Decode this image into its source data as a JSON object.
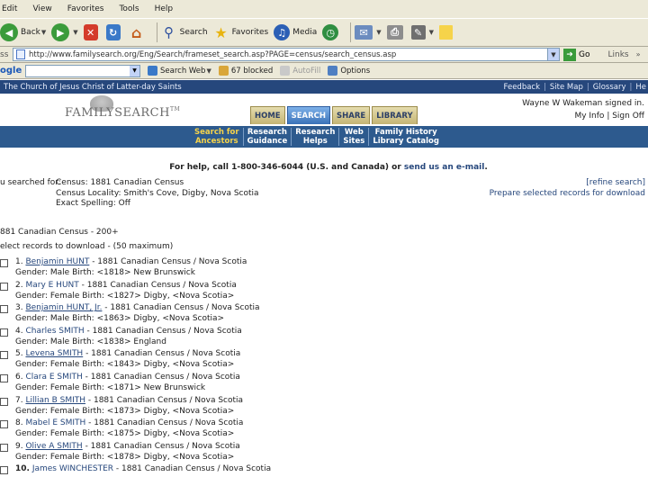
{
  "menu": [
    "Edit",
    "View",
    "Favorites",
    "Tools",
    "Help"
  ],
  "toolbar": {
    "back": "Back",
    "search": "Search",
    "favorites": "Favorites",
    "media": "Media"
  },
  "address": {
    "label": "ss",
    "url": "http://www.familysearch.org/Eng/Search/frameset_search.asp?PAGE=census/search_census.asp",
    "go": "Go",
    "links": "Links",
    "links_caret": "»"
  },
  "google": {
    "logo": "ogle",
    "search_web": "Search Web",
    "blocked": "67 blocked",
    "autofill": "AutoFill",
    "options": "Options"
  },
  "site": {
    "church_title": "The Church of Jesus Christ of Latter-day Saints",
    "top_links": [
      "Feedback",
      "Site Map",
      "Glossary",
      "He"
    ],
    "logo": "FAMILYSEARCH",
    "tm": "TM",
    "tabs": [
      "HOME",
      "SEARCH",
      "SHARE",
      "LIBRARY"
    ],
    "signed_in": "Wayne W Wakeman signed in.",
    "my_info": "My Info",
    "sign_off": "Sign Off",
    "subnav": [
      {
        "line1": "Search for",
        "line2": "Ancestors"
      },
      {
        "line1": "Research",
        "line2": "Guidance"
      },
      {
        "line1": "Research",
        "line2": "Helps"
      },
      {
        "line1": "Web",
        "line2": "Sites"
      },
      {
        "line1": "Family History",
        "line2": "Library Catalog"
      }
    ]
  },
  "help": {
    "prefix": "For help, call 1-800-346-6044 (U.S. and Canada) or ",
    "link": "send us an e-mail",
    "suffix": "."
  },
  "criteria": {
    "label": "u searched for:",
    "values": [
      "Census: 1881 Canadian Census",
      "Census Locality: Smith's Cove, Digby, Nova Scotia",
      "Exact Spelling: Off"
    ],
    "refine": "[refine search]",
    "prepare": "Prepare selected records for download"
  },
  "results": {
    "heading": "881 Canadian Census - 200+",
    "select_text": "elect records to download - (50 maximum)",
    "items": [
      {
        "num": "1.",
        "name": "Benjamin HUNT",
        "rest": " - 1881 Canadian Census / Nova Scotia",
        "detail": "Gender: Male   Birth: <1818> New Brunswick",
        "link": true
      },
      {
        "num": "2.",
        "name": "Mary E HUNT",
        "rest": " - 1881 Canadian Census / Nova Scotia",
        "detail": "Gender: Female   Birth: <1827> Digby, <Nova Scotia>",
        "link": false
      },
      {
        "num": "3.",
        "name": "Benjamin HUNT, Jr.",
        "rest": " - 1881 Canadian Census / Nova Scotia",
        "detail": "Gender: Male   Birth: <1863> Digby, <Nova Scotia>",
        "link": true
      },
      {
        "num": "4.",
        "name": "Charles SMITH",
        "rest": " - 1881 Canadian Census / Nova Scotia",
        "detail": "Gender: Male   Birth: <1838> England",
        "link": false
      },
      {
        "num": "5.",
        "name": "Levena SMITH",
        "rest": " - 1881 Canadian Census / Nova Scotia",
        "detail": "Gender: Female   Birth: <1843> Digby, <Nova Scotia>",
        "link": true
      },
      {
        "num": "6.",
        "name": "Clara E SMITH",
        "rest": " - 1881 Canadian Census / Nova Scotia",
        "detail": "Gender: Female   Birth: <1871> New Brunswick",
        "link": false
      },
      {
        "num": "7.",
        "name": "Lillian B SMITH",
        "rest": " - 1881 Canadian Census / Nova Scotia",
        "detail": "Gender: Female   Birth: <1873> Digby, <Nova Scotia>",
        "link": true
      },
      {
        "num": "8.",
        "name": "Mabel E SMITH",
        "rest": " - 1881 Canadian Census / Nova Scotia",
        "detail": "Gender: Female   Birth: <1875> Digby, <Nova Scotia>",
        "link": false
      },
      {
        "num": "9.",
        "name": "Olive A SMITH",
        "rest": " - 1881 Canadian Census / Nova Scotia",
        "detail": "Gender: Female   Birth: <1878> Digby, <Nova Scotia>",
        "link": true
      },
      {
        "num": "10.",
        "name": "James WINCHESTER",
        "rest": " - 1881 Canadian Census / Nova Scotia",
        "detail": "",
        "link": false,
        "bold_num": true
      }
    ]
  }
}
